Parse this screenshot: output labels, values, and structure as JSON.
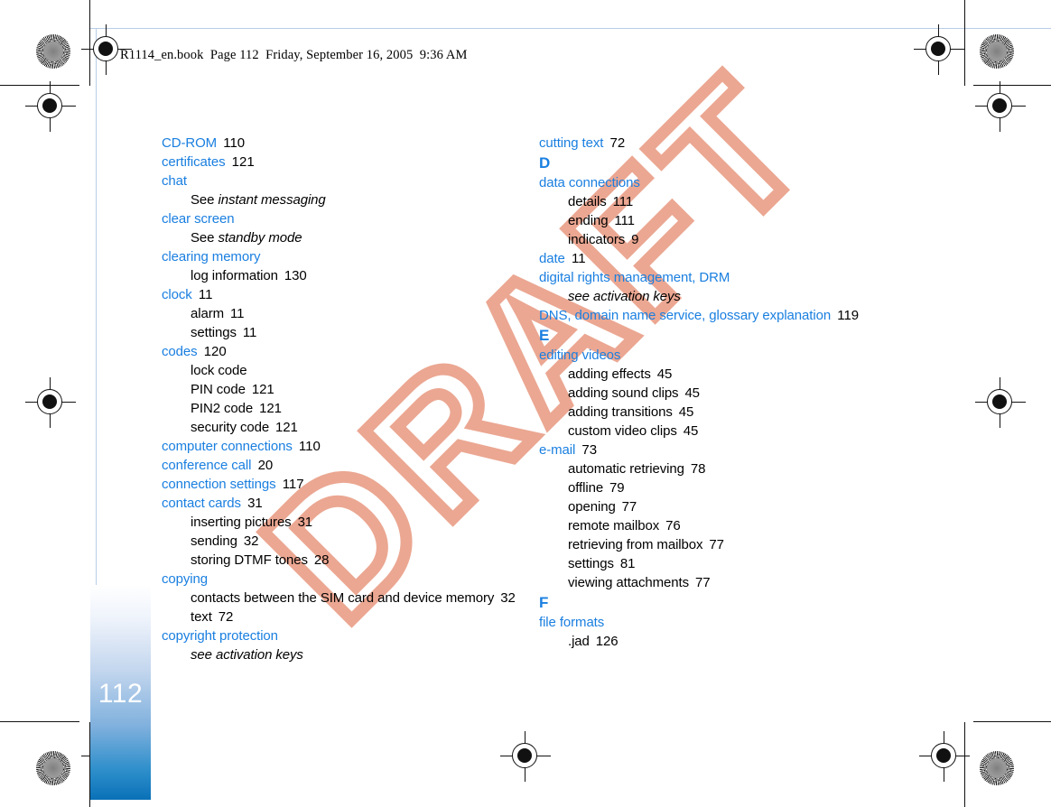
{
  "running_head": "R1114_en.book  Page 112  Friday, September 16, 2005  9:36 AM",
  "watermark": "DRAFT",
  "page_number": "112",
  "colors": {
    "entry_blue": "#1a7fe0",
    "watermark_salmon": "#eba792",
    "sidebar_blue_bottom": "#0a71b8",
    "page_number_text": "#ffffff"
  },
  "columns": {
    "left": [
      {
        "type": "entry",
        "text": "CD-ROM",
        "page": "110"
      },
      {
        "type": "entry",
        "text": "certificates",
        "page": "121"
      },
      {
        "type": "entry",
        "text": "chat",
        "page": ""
      },
      {
        "type": "sub_see",
        "see": "See",
        "ref": "instant messaging"
      },
      {
        "type": "entry",
        "text": "clear screen",
        "page": ""
      },
      {
        "type": "sub_see",
        "see": "See",
        "ref": "standby mode"
      },
      {
        "type": "entry",
        "text": "clearing memory",
        "page": ""
      },
      {
        "type": "sub",
        "text": "log information",
        "page": "130"
      },
      {
        "type": "entry",
        "text": "clock",
        "page": "11"
      },
      {
        "type": "sub",
        "text": "alarm",
        "page": "11"
      },
      {
        "type": "sub",
        "text": "settings",
        "page": "11"
      },
      {
        "type": "entry",
        "text": "codes",
        "page": "120"
      },
      {
        "type": "sub",
        "text": "lock code",
        "page": ""
      },
      {
        "type": "sub",
        "text": "PIN code",
        "page": "121"
      },
      {
        "type": "sub",
        "text": "PIN2 code",
        "page": "121"
      },
      {
        "type": "sub",
        "text": "security code",
        "page": "121"
      },
      {
        "type": "entry",
        "text": "computer connections",
        "page": "110"
      },
      {
        "type": "entry",
        "text": "conference call",
        "page": "20"
      },
      {
        "type": "entry",
        "text": "connection settings",
        "page": "117"
      },
      {
        "type": "entry",
        "text": "contact cards",
        "page": "31"
      },
      {
        "type": "sub",
        "text": "inserting pictures",
        "page": "31"
      },
      {
        "type": "sub",
        "text": "sending",
        "page": "32"
      },
      {
        "type": "sub",
        "text": "storing DTMF tones",
        "page": "28"
      },
      {
        "type": "entry",
        "text": "copying",
        "page": ""
      },
      {
        "type": "sub",
        "text": "contacts between the SIM card and device memory",
        "page": "32"
      },
      {
        "type": "sub",
        "text": "text",
        "page": "72"
      },
      {
        "type": "entry",
        "text": "copyright protection",
        "page": ""
      },
      {
        "type": "sub_italic",
        "text": "see activation keys"
      }
    ],
    "right": [
      {
        "type": "entry",
        "text": "cutting text",
        "page": "72"
      },
      {
        "type": "letter",
        "text": "D"
      },
      {
        "type": "entry",
        "text": "data connections",
        "page": ""
      },
      {
        "type": "sub",
        "text": "details",
        "page": "111"
      },
      {
        "type": "sub",
        "text": "ending",
        "page": "111"
      },
      {
        "type": "sub",
        "text": "indicators",
        "page": "9"
      },
      {
        "type": "entry",
        "text": "date",
        "page": "11"
      },
      {
        "type": "entry",
        "text": "digital rights management, DRM",
        "page": ""
      },
      {
        "type": "sub_italic",
        "text": "see activation keys"
      },
      {
        "type": "entry",
        "text": "DNS, domain name service, glossary explanation",
        "page": "119"
      },
      {
        "type": "letter",
        "text": "E"
      },
      {
        "type": "entry",
        "text": "editing videos",
        "page": ""
      },
      {
        "type": "sub",
        "text": "adding effects",
        "page": "45"
      },
      {
        "type": "sub",
        "text": "adding sound clips",
        "page": "45"
      },
      {
        "type": "sub",
        "text": "adding transitions",
        "page": "45"
      },
      {
        "type": "sub",
        "text": "custom video clips",
        "page": "45"
      },
      {
        "type": "entry",
        "text": "e-mail",
        "page": "73"
      },
      {
        "type": "sub",
        "text": "automatic retrieving",
        "page": "78"
      },
      {
        "type": "sub",
        "text": "offline",
        "page": "79"
      },
      {
        "type": "sub",
        "text": "opening",
        "page": "77"
      },
      {
        "type": "sub",
        "text": "remote mailbox",
        "page": "76"
      },
      {
        "type": "sub",
        "text": "retrieving from mailbox",
        "page": "77"
      },
      {
        "type": "sub",
        "text": "settings",
        "page": "81"
      },
      {
        "type": "sub",
        "text": "viewing attachments",
        "page": "77"
      },
      {
        "type": "letter",
        "text": "F"
      },
      {
        "type": "entry",
        "text": "file formats",
        "page": ""
      },
      {
        "type": "sub",
        "text": ".jad",
        "page": "126"
      }
    ]
  }
}
